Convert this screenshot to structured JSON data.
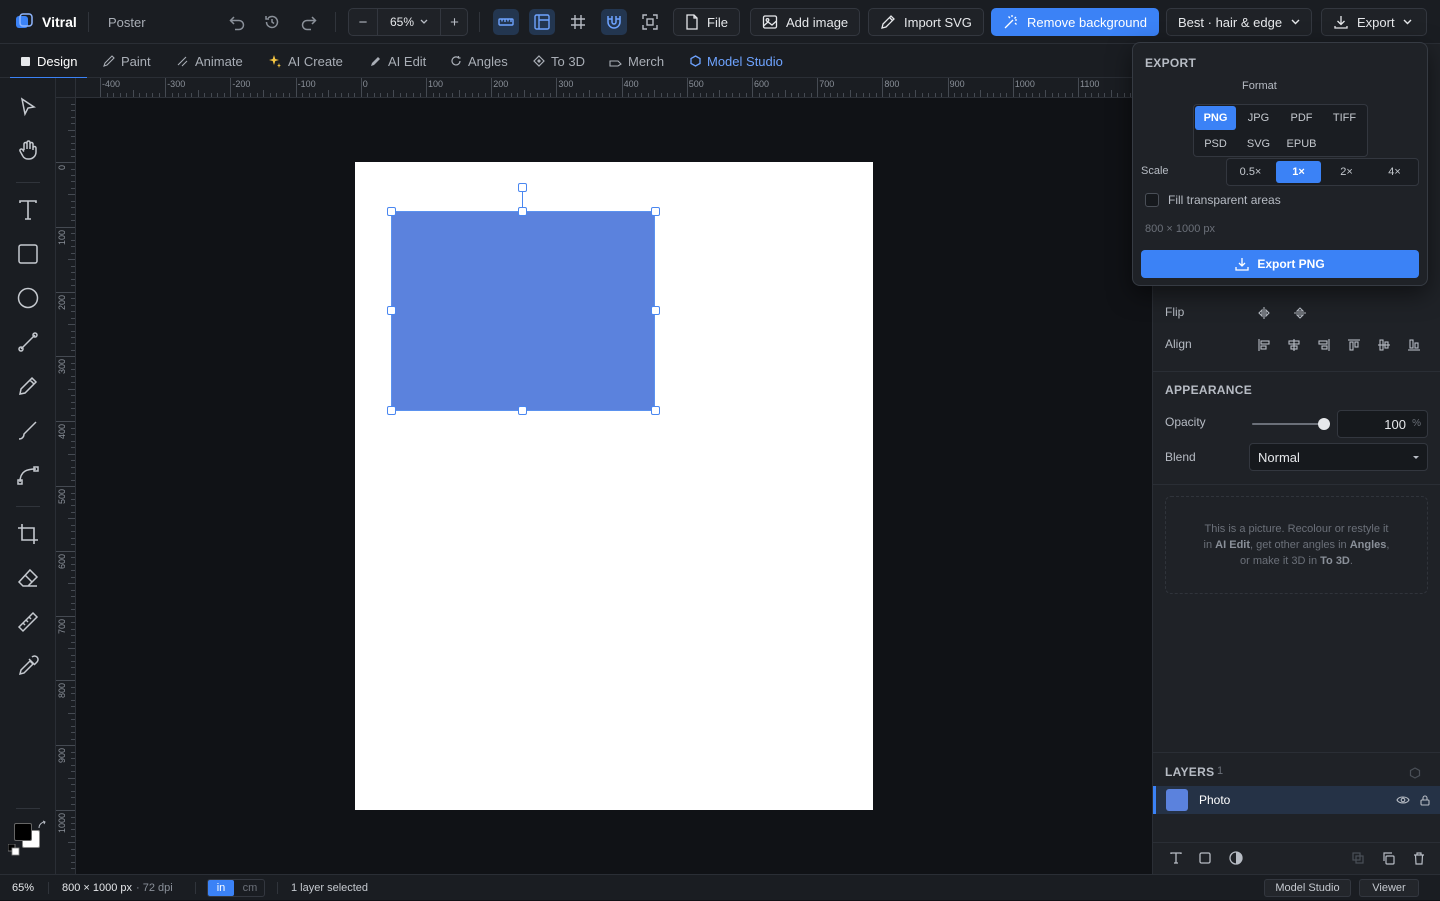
{
  "app": {
    "name": "Vitral",
    "document": "Poster"
  },
  "toolbar_top": {
    "zoom": "65%",
    "file": "File",
    "add_image": "Add image",
    "import_svg": "Import SVG",
    "remove_bg": "Remove background",
    "quality": "Best · hair & edge",
    "export": "Export"
  },
  "tabs": [
    "Design",
    "Paint",
    "Animate",
    "AI Create",
    "AI Edit",
    "Angles",
    "To 3D",
    "Merch",
    "Model Studio"
  ],
  "ruler": {
    "h": [
      "-400",
      "-300",
      "-200",
      "-100",
      "0",
      "100",
      "200",
      "300",
      "400",
      "500",
      "600",
      "700",
      "800",
      "900",
      "1000",
      "1100"
    ],
    "v": [
      "0",
      "100",
      "200",
      "300",
      "400",
      "500",
      "600",
      "700",
      "800",
      "900",
      "1000"
    ]
  },
  "export_panel": {
    "title": "EXPORT",
    "format_label": "Format",
    "formats": [
      "PNG",
      "JPG",
      "PDF",
      "TIFF",
      "PSD",
      "SVG",
      "EPUB"
    ],
    "selected_format": "PNG",
    "scale_label": "Scale",
    "scales": [
      "0.5×",
      "1×",
      "2×",
      "4×"
    ],
    "selected_scale": "1×",
    "fill_transparent": "Fill transparent areas",
    "dimensions": "800 × 1000 px",
    "button": "Export PNG"
  },
  "properties": {
    "flip": "Flip",
    "align": "Align",
    "appearance": "APPEARANCE",
    "opacity_label": "Opacity",
    "opacity_value": "100",
    "opacity_unit": "%",
    "opacity_level": 1.0,
    "blend_label": "Blend",
    "blend_value": "Normal",
    "hint": {
      "p1": "This is a picture. Recolour or restyle it",
      "p2": "in ",
      "ai_edit": "AI Edit",
      "p3": ", get other angles in ",
      "angles": "Angles",
      "p4": ",",
      "p5": "or make it 3D in ",
      "to3d": "To 3D",
      "p6": "."
    }
  },
  "layers": {
    "title": "LAYERS",
    "count": "1",
    "items": [
      {
        "name": "Photo",
        "color": "#5b82dd"
      }
    ]
  },
  "status": {
    "zoom": "65%",
    "size": "800 × 1000 px",
    "dpi": "· 72 dpi",
    "unit_in": "in",
    "unit_cm": "cm",
    "selection": "1 layer selected",
    "model_studio": "Model Studio",
    "viewer": "Viewer"
  },
  "colors": {
    "accent": "#3b82f6",
    "shape": "#5b82dd",
    "page": "#ffffff",
    "canvas": "#101216"
  }
}
